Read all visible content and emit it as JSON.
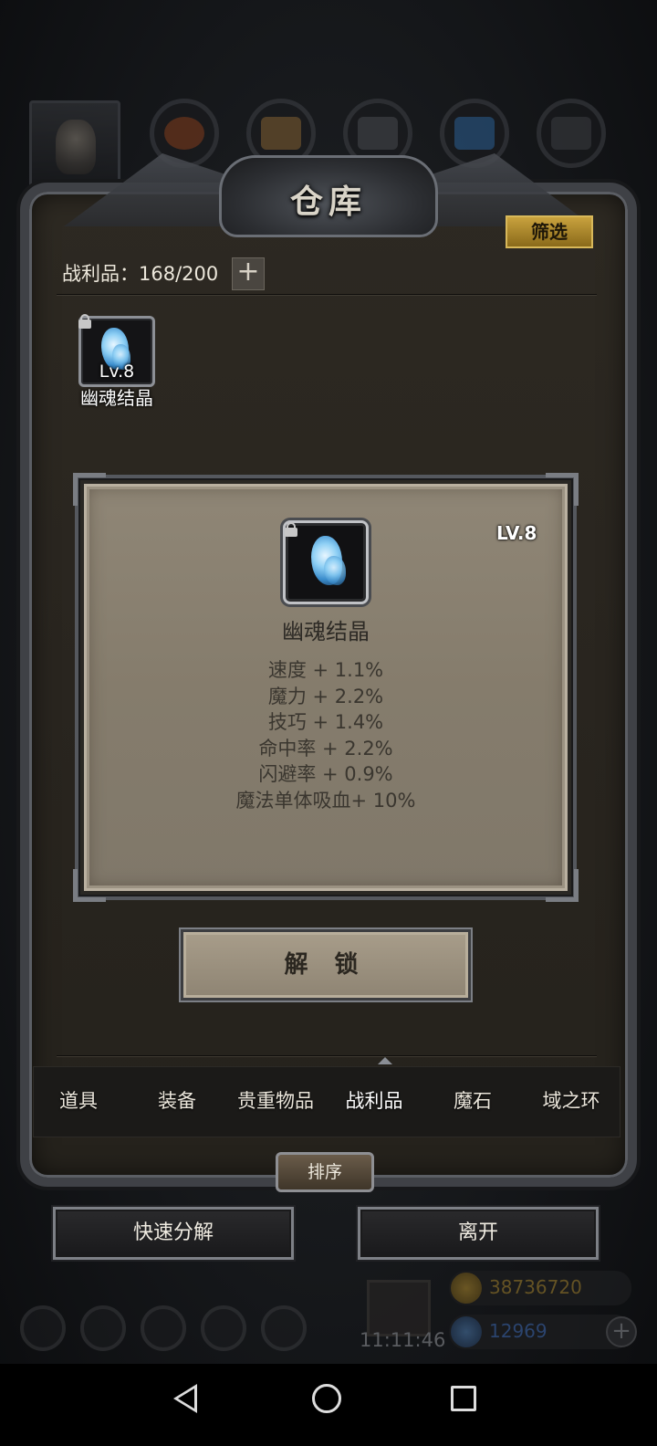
{
  "panel": {
    "title": "仓库",
    "filter_label": "筛选",
    "loot_count": "战利品：168/200",
    "add_label": "+"
  },
  "grid": {
    "items": [
      {
        "level": "Lv.8",
        "name": "幽魂结晶",
        "locked": true,
        "icon": "ghost-crystal-icon"
      }
    ]
  },
  "detail": {
    "level": "LV.8",
    "name": "幽魂结晶",
    "icon": "ghost-crystal-icon",
    "stats": [
      "速度 + 1.1%",
      "魔力 + 2.2%",
      "技巧 + 1.4%",
      "命中率 + 2.2%",
      "闪避率 + 0.9%",
      "魔法单体吸血+ 10%"
    ],
    "unlock_label": "解 锁"
  },
  "tabs": {
    "items": [
      "道具",
      "装备",
      "贵重物品",
      "战利品",
      "魔石",
      "域之环"
    ],
    "active": "战利品"
  },
  "sort_label": "排序",
  "actions": {
    "decompose_label": "快速分解",
    "leave_label": "离开"
  },
  "hud": {
    "time": "11:11:46",
    "gold": "38736720",
    "gems": "12969",
    "add_label": "+"
  },
  "colors": {
    "filter_gold": "#c9a23e",
    "card_parchment": "#8a8171",
    "gold_text": "#8a6a1a",
    "gem_text": "#2b4a8a"
  }
}
